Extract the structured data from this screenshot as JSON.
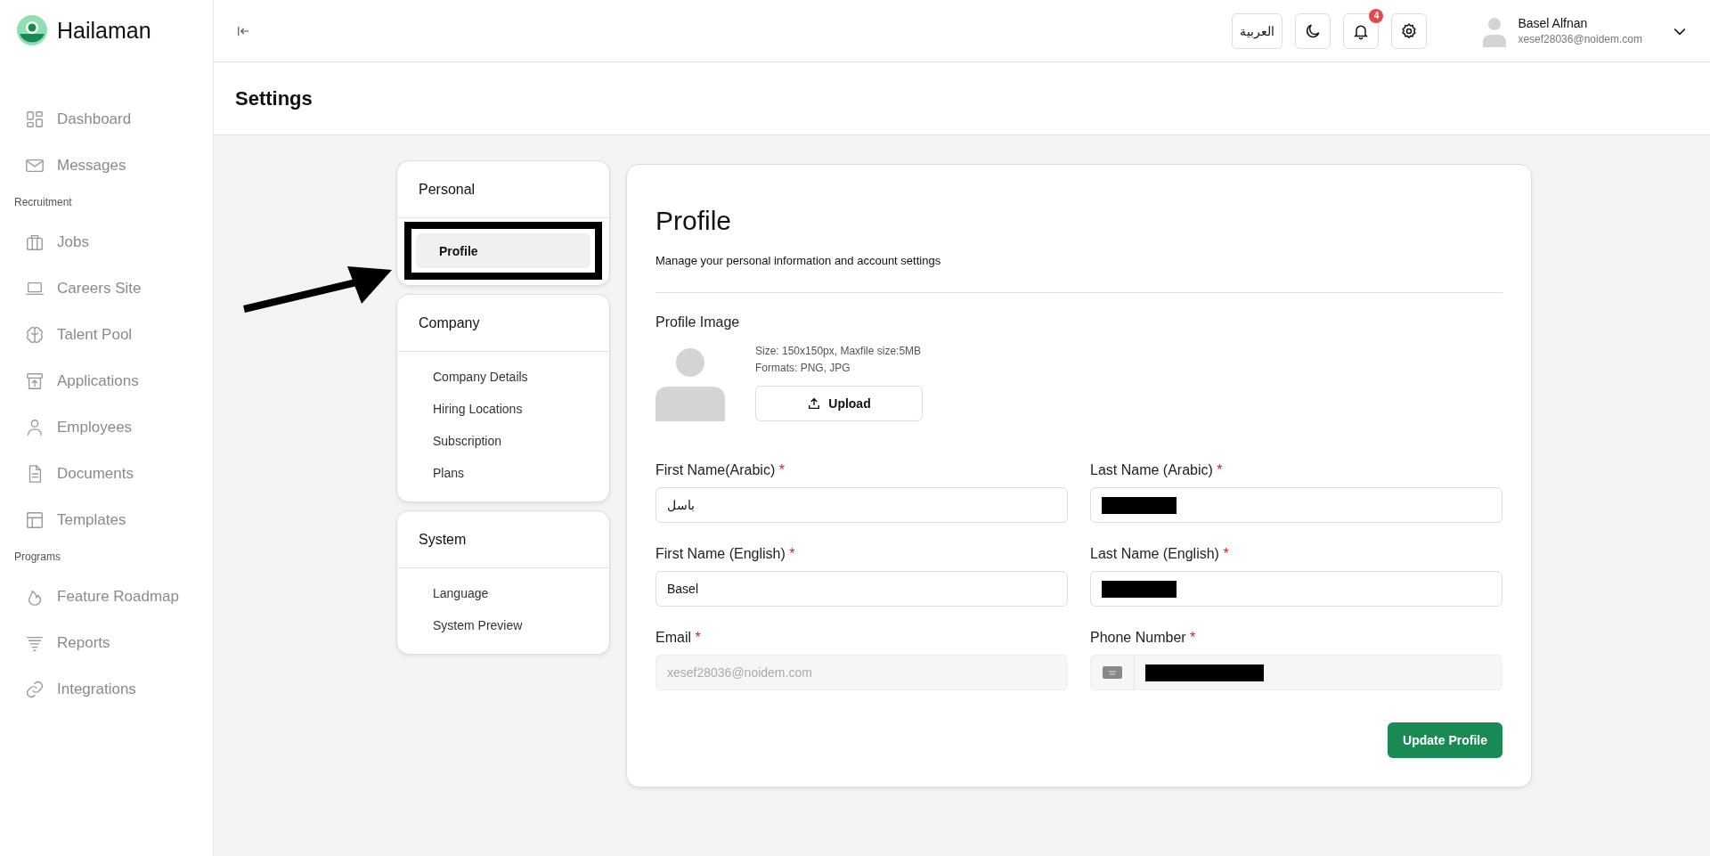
{
  "brand": {
    "name": "Hailaman"
  },
  "sidebar": {
    "items": [
      {
        "kind": "item",
        "label": "Dashboard"
      },
      {
        "kind": "item",
        "label": "Messages"
      },
      {
        "kind": "section",
        "label": "Recruitment"
      },
      {
        "kind": "item",
        "label": "Jobs"
      },
      {
        "kind": "item",
        "label": "Careers Site"
      },
      {
        "kind": "item",
        "label": "Talent Pool"
      },
      {
        "kind": "item",
        "label": "Applications"
      },
      {
        "kind": "item",
        "label": "Employees"
      },
      {
        "kind": "item",
        "label": "Documents"
      },
      {
        "kind": "item",
        "label": "Templates"
      },
      {
        "kind": "section",
        "label": "Programs"
      },
      {
        "kind": "item",
        "label": "Feature Roadmap"
      },
      {
        "kind": "item",
        "label": "Reports"
      },
      {
        "kind": "item",
        "label": "Integrations"
      }
    ]
  },
  "topbar": {
    "language": "العربية",
    "notifications": "4",
    "user": {
      "name": "Basel Alfnan",
      "email": "xesef28036@noidem.com"
    }
  },
  "page_title": "Settings",
  "settings_nav": [
    {
      "title": "Personal",
      "items": [
        {
          "label": "Profile",
          "selected": true,
          "highlighted": true
        }
      ]
    },
    {
      "title": "Company",
      "items": [
        {
          "label": "Company Details",
          "selected": false,
          "highlighted": false
        },
        {
          "label": "Hiring Locations",
          "selected": false,
          "highlighted": false
        },
        {
          "label": "Subscription",
          "selected": false,
          "highlighted": false
        },
        {
          "label": "Plans",
          "selected": false,
          "highlighted": false
        }
      ]
    },
    {
      "title": "System",
      "items": [
        {
          "label": "Language",
          "selected": false,
          "highlighted": false
        },
        {
          "label": "System Preview",
          "selected": false,
          "highlighted": false
        }
      ]
    }
  ],
  "profile": {
    "title": "Profile",
    "subtitle": "Manage your personal information and account settings",
    "image": {
      "label": "Profile Image",
      "hint_size": "Size: 150x150px, Maxfile size:5MB",
      "hint_formats": "Formats: PNG, JPG",
      "upload": "Upload"
    },
    "fields": [
      {
        "kind": "text",
        "label": "First Name(Arabic)",
        "required_mark": "*",
        "value": "باسل",
        "redacted": false
      },
      {
        "kind": "text",
        "label": "Last Name (Arabic)",
        "required_mark": "*",
        "redacted": true
      },
      {
        "kind": "text",
        "label": "First Name (English)",
        "required_mark": "*",
        "value": "Basel",
        "redacted": false
      },
      {
        "kind": "text",
        "label": "Last Name (English)",
        "required_mark": "*",
        "redacted": true
      },
      {
        "kind": "disabled",
        "label": "Email",
        "required_mark": "*",
        "value": "xesef28036@noidem.com",
        "redacted": false
      },
      {
        "kind": "phone",
        "label": "Phone Number",
        "required_mark": "*",
        "redacted": true
      }
    ],
    "submit": "Update Profile"
  }
}
